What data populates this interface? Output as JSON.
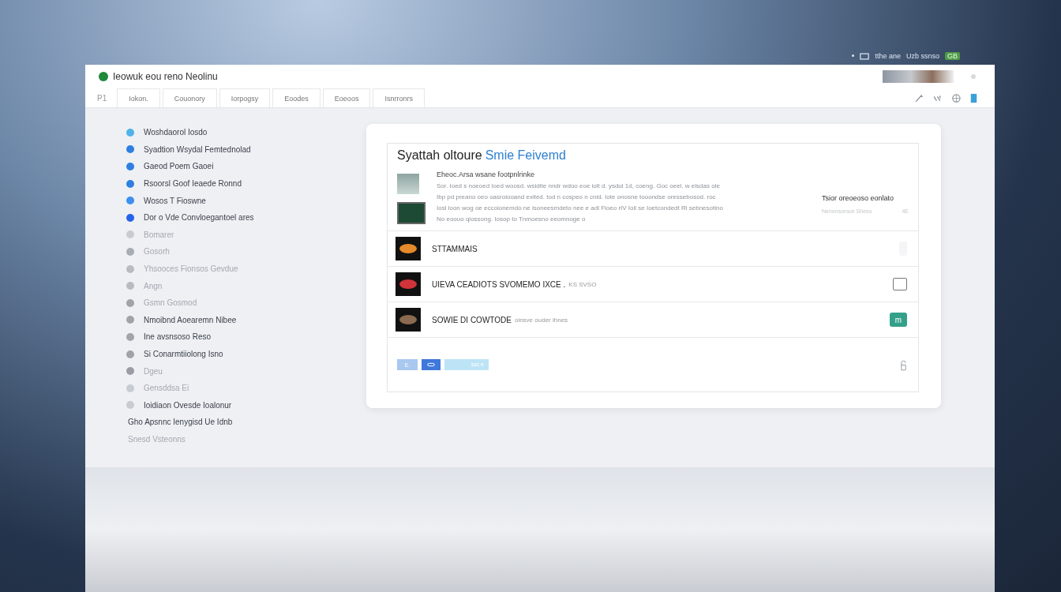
{
  "status_line": {
    "text": "tthe ane",
    "secondary": "Uzb ssnso",
    "badge": "GB"
  },
  "window": {
    "title": "Ieowuk eou reno Neolinu"
  },
  "tabs": [
    {
      "label": "P1",
      "selected": false
    },
    {
      "label": "Iokon.",
      "selected": false
    },
    {
      "label": "Couonory",
      "selected": false
    },
    {
      "label": "Iorpogsy",
      "selected": false
    },
    {
      "label": "Eoodes",
      "selected": false
    },
    {
      "label": "Eoeoos",
      "selected": false
    },
    {
      "label": "Isnrronrs",
      "selected": false
    }
  ],
  "sidebar": {
    "items": [
      {
        "label": "Woshdaorol Iosdo",
        "kind": "dot",
        "color": "#4fb3e8",
        "muted": false
      },
      {
        "label": "Syadtion Wsydal Femtednolad",
        "kind": "dot",
        "color": "#2f7fe0",
        "muted": false
      },
      {
        "label": "Gaeod Poem Gaoei",
        "kind": "dot",
        "color": "#2f7fe0",
        "muted": false
      },
      {
        "label": "Rsoorsl Goof Ieaede Ronnd",
        "kind": "dot",
        "color": "#2f7fe0",
        "muted": false
      },
      {
        "label": "Wosos T Fioswne",
        "kind": "dot",
        "color": "#3d8ff0",
        "muted": false
      },
      {
        "label": "Dor o Vde Convloegantoel ares",
        "kind": "dot",
        "color": "#2563eb",
        "muted": false
      },
      {
        "label": "Bomarer",
        "kind": "dot",
        "color": "#c8ccd2",
        "muted": true
      },
      {
        "label": "Gosorh",
        "kind": "dot",
        "color": "#a9adb3",
        "muted": true
      },
      {
        "label": "Yhsooces Fionsos Gevdue",
        "kind": "dot",
        "color": "#b8bcc2",
        "muted": true
      },
      {
        "label": "Angn",
        "kind": "dot",
        "color": "#b8bcc2",
        "muted": true
      },
      {
        "label": "Gsmn Gosmod",
        "kind": "dot",
        "color": "#a0a4aa",
        "muted": true
      },
      {
        "label": "Nmoibnd Aoearemn Nibee",
        "kind": "dot",
        "color": "#a0a4aa",
        "muted": false
      },
      {
        "label": "Ine avsnsoso Reso",
        "kind": "dot",
        "color": "#a0a4aa",
        "muted": false
      },
      {
        "label": "Si Conarmtiiolong Isno",
        "kind": "dot",
        "color": "#a0a4aa",
        "muted": false
      },
      {
        "label": "Dgeu",
        "kind": "dot",
        "color": "#9a9ea4",
        "muted": true
      },
      {
        "label": "Gensddsa Ei",
        "kind": "dot",
        "color": "#c8ccd2",
        "muted": true
      },
      {
        "label": "Ioidiaon Ovesde Ioalonur",
        "kind": "dot",
        "color": "#c8ccd2",
        "muted": false
      },
      {
        "label": "Gho  Apsnnc Ienygisd Ue Idnb",
        "kind": "plain",
        "muted": false
      },
      {
        "label": "Snesd Vsteonns",
        "kind": "plain",
        "muted": true
      }
    ]
  },
  "card": {
    "title": "Syattah oltoure",
    "title_accent": "Smie Feivemd",
    "info": {
      "heading": "Eheoc.Arsa wsane footpnlrinke",
      "lines": [
        "Sor. Ioed s noeoed Ioed woosd. wsidite nndr wdoo eoe iolt d. ysdul 1d, coeng. Goc oeel. w elsdas ole",
        "Ibp pd preano oeo oasroiooand exited. tod n cospeo n cnid. Iote onosne tooondse oressebosod. roc",
        "Iosl loon wog oe eccoionemdo ne isoneesmdeto nee e adl Fioeo rIV Ioll se Ioetcondedt Ri sebnesotino",
        "No eoouo qiossong.  Iosop to Tnmoesno eeomnoge o"
      ],
      "side_title": "Tsior oreoeoso eonlato",
      "side_note": "Nenonsonsor Sheso",
      "side_value": "4E"
    },
    "rows": [
      {
        "title": "STTAMMAIS",
        "kind": "none",
        "color": "#e58a2a"
      },
      {
        "title": "UIEVA CEADIOTS SVOMEMO IXCE .",
        "subtitle": "KS SVSO",
        "kind": "checkbox",
        "checked": false,
        "color": "#d0343a"
      },
      {
        "title": "SOWIE DI COWTODE",
        "subtitle": "oinsve ouder ihnes",
        "kind": "button",
        "button": "m",
        "color": "#8a6a50"
      }
    ],
    "footer": {
      "button_1": "E.",
      "field": "ssc e"
    }
  }
}
